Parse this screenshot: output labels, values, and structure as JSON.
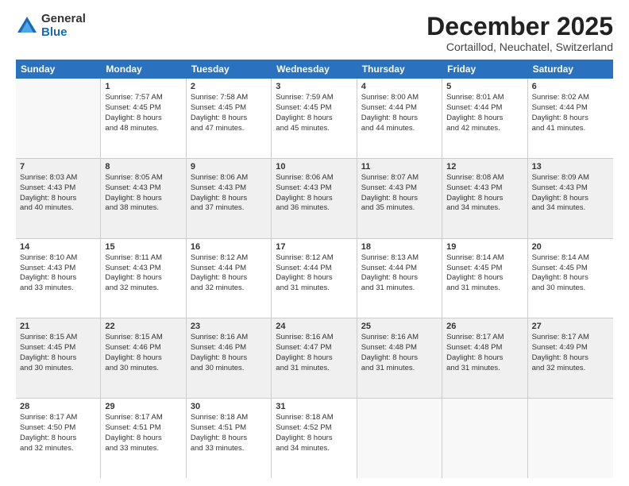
{
  "logo": {
    "general": "General",
    "blue": "Blue"
  },
  "title": "December 2025",
  "location": "Cortaillod, Neuchatel, Switzerland",
  "days": [
    "Sunday",
    "Monday",
    "Tuesday",
    "Wednesday",
    "Thursday",
    "Friday",
    "Saturday"
  ],
  "rows": [
    [
      {
        "day": "",
        "lines": [],
        "empty": true
      },
      {
        "day": "1",
        "lines": [
          "Sunrise: 7:57 AM",
          "Sunset: 4:45 PM",
          "Daylight: 8 hours",
          "and 48 minutes."
        ]
      },
      {
        "day": "2",
        "lines": [
          "Sunrise: 7:58 AM",
          "Sunset: 4:45 PM",
          "Daylight: 8 hours",
          "and 47 minutes."
        ]
      },
      {
        "day": "3",
        "lines": [
          "Sunrise: 7:59 AM",
          "Sunset: 4:45 PM",
          "Daylight: 8 hours",
          "and 45 minutes."
        ]
      },
      {
        "day": "4",
        "lines": [
          "Sunrise: 8:00 AM",
          "Sunset: 4:44 PM",
          "Daylight: 8 hours",
          "and 44 minutes."
        ]
      },
      {
        "day": "5",
        "lines": [
          "Sunrise: 8:01 AM",
          "Sunset: 4:44 PM",
          "Daylight: 8 hours",
          "and 42 minutes."
        ]
      },
      {
        "day": "6",
        "lines": [
          "Sunrise: 8:02 AM",
          "Sunset: 4:44 PM",
          "Daylight: 8 hours",
          "and 41 minutes."
        ]
      }
    ],
    [
      {
        "day": "7",
        "lines": [
          "Sunrise: 8:03 AM",
          "Sunset: 4:43 PM",
          "Daylight: 8 hours",
          "and 40 minutes."
        ],
        "shaded": true
      },
      {
        "day": "8",
        "lines": [
          "Sunrise: 8:05 AM",
          "Sunset: 4:43 PM",
          "Daylight: 8 hours",
          "and 38 minutes."
        ],
        "shaded": true
      },
      {
        "day": "9",
        "lines": [
          "Sunrise: 8:06 AM",
          "Sunset: 4:43 PM",
          "Daylight: 8 hours",
          "and 37 minutes."
        ],
        "shaded": true
      },
      {
        "day": "10",
        "lines": [
          "Sunrise: 8:06 AM",
          "Sunset: 4:43 PM",
          "Daylight: 8 hours",
          "and 36 minutes."
        ],
        "shaded": true
      },
      {
        "day": "11",
        "lines": [
          "Sunrise: 8:07 AM",
          "Sunset: 4:43 PM",
          "Daylight: 8 hours",
          "and 35 minutes."
        ],
        "shaded": true
      },
      {
        "day": "12",
        "lines": [
          "Sunrise: 8:08 AM",
          "Sunset: 4:43 PM",
          "Daylight: 8 hours",
          "and 34 minutes."
        ],
        "shaded": true
      },
      {
        "day": "13",
        "lines": [
          "Sunrise: 8:09 AM",
          "Sunset: 4:43 PM",
          "Daylight: 8 hours",
          "and 34 minutes."
        ],
        "shaded": true
      }
    ],
    [
      {
        "day": "14",
        "lines": [
          "Sunrise: 8:10 AM",
          "Sunset: 4:43 PM",
          "Daylight: 8 hours",
          "and 33 minutes."
        ]
      },
      {
        "day": "15",
        "lines": [
          "Sunrise: 8:11 AM",
          "Sunset: 4:43 PM",
          "Daylight: 8 hours",
          "and 32 minutes."
        ]
      },
      {
        "day": "16",
        "lines": [
          "Sunrise: 8:12 AM",
          "Sunset: 4:44 PM",
          "Daylight: 8 hours",
          "and 32 minutes."
        ]
      },
      {
        "day": "17",
        "lines": [
          "Sunrise: 8:12 AM",
          "Sunset: 4:44 PM",
          "Daylight: 8 hours",
          "and 31 minutes."
        ]
      },
      {
        "day": "18",
        "lines": [
          "Sunrise: 8:13 AM",
          "Sunset: 4:44 PM",
          "Daylight: 8 hours",
          "and 31 minutes."
        ]
      },
      {
        "day": "19",
        "lines": [
          "Sunrise: 8:14 AM",
          "Sunset: 4:45 PM",
          "Daylight: 8 hours",
          "and 31 minutes."
        ]
      },
      {
        "day": "20",
        "lines": [
          "Sunrise: 8:14 AM",
          "Sunset: 4:45 PM",
          "Daylight: 8 hours",
          "and 30 minutes."
        ]
      }
    ],
    [
      {
        "day": "21",
        "lines": [
          "Sunrise: 8:15 AM",
          "Sunset: 4:45 PM",
          "Daylight: 8 hours",
          "and 30 minutes."
        ],
        "shaded": true
      },
      {
        "day": "22",
        "lines": [
          "Sunrise: 8:15 AM",
          "Sunset: 4:46 PM",
          "Daylight: 8 hours",
          "and 30 minutes."
        ],
        "shaded": true
      },
      {
        "day": "23",
        "lines": [
          "Sunrise: 8:16 AM",
          "Sunset: 4:46 PM",
          "Daylight: 8 hours",
          "and 30 minutes."
        ],
        "shaded": true
      },
      {
        "day": "24",
        "lines": [
          "Sunrise: 8:16 AM",
          "Sunset: 4:47 PM",
          "Daylight: 8 hours",
          "and 31 minutes."
        ],
        "shaded": true
      },
      {
        "day": "25",
        "lines": [
          "Sunrise: 8:16 AM",
          "Sunset: 4:48 PM",
          "Daylight: 8 hours",
          "and 31 minutes."
        ],
        "shaded": true
      },
      {
        "day": "26",
        "lines": [
          "Sunrise: 8:17 AM",
          "Sunset: 4:48 PM",
          "Daylight: 8 hours",
          "and 31 minutes."
        ],
        "shaded": true
      },
      {
        "day": "27",
        "lines": [
          "Sunrise: 8:17 AM",
          "Sunset: 4:49 PM",
          "Daylight: 8 hours",
          "and 32 minutes."
        ],
        "shaded": true
      }
    ],
    [
      {
        "day": "28",
        "lines": [
          "Sunrise: 8:17 AM",
          "Sunset: 4:50 PM",
          "Daylight: 8 hours",
          "and 32 minutes."
        ]
      },
      {
        "day": "29",
        "lines": [
          "Sunrise: 8:17 AM",
          "Sunset: 4:51 PM",
          "Daylight: 8 hours",
          "and 33 minutes."
        ]
      },
      {
        "day": "30",
        "lines": [
          "Sunrise: 8:18 AM",
          "Sunset: 4:51 PM",
          "Daylight: 8 hours",
          "and 33 minutes."
        ]
      },
      {
        "day": "31",
        "lines": [
          "Sunrise: 8:18 AM",
          "Sunset: 4:52 PM",
          "Daylight: 8 hours",
          "and 34 minutes."
        ]
      },
      {
        "day": "",
        "lines": [],
        "empty": true
      },
      {
        "day": "",
        "lines": [],
        "empty": true
      },
      {
        "day": "",
        "lines": [],
        "empty": true
      }
    ]
  ]
}
